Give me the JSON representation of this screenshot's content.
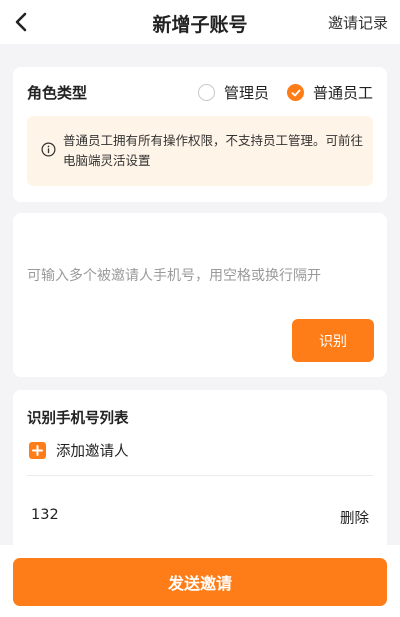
{
  "header": {
    "title": "新增子账号",
    "records_label": "邀请记录",
    "back_icon": "chevron-left-icon"
  },
  "role": {
    "label": "角色类型",
    "options": [
      {
        "label": "管理员",
        "selected": false
      },
      {
        "label": "普通员工",
        "selected": true
      }
    ],
    "notice": "普通员工拥有所有操作权限，不支持员工管理。可前往电脑端灵活设置",
    "notice_icon": "info-icon"
  },
  "input": {
    "placeholder": "可输入多个被邀请人手机号，用空格或换行隔开",
    "recognize_label": "识别"
  },
  "phone_list": {
    "title": "识别手机号列表",
    "add_label": "添加邀请人",
    "items": [
      {
        "number": "132",
        "delete_label": "删除"
      }
    ]
  },
  "footer": {
    "send_label": "发送邀请"
  },
  "colors": {
    "accent": "#ff7d18",
    "notice_bg": "#fff4e8",
    "page_bg": "#f4f4f6"
  }
}
